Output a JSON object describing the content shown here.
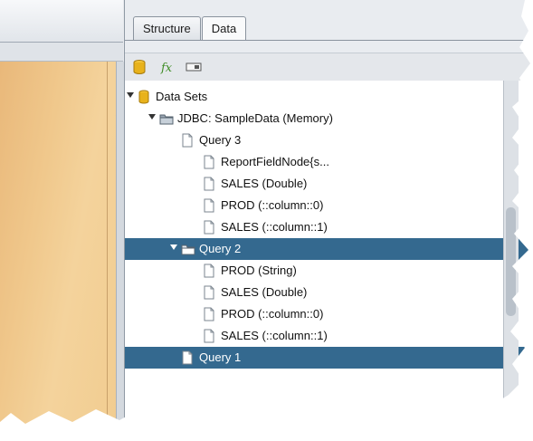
{
  "tabs": [
    {
      "label": "Structure",
      "active": false
    },
    {
      "label": "Data",
      "active": true
    }
  ],
  "toolbar": {
    "buttons": [
      {
        "icon": "database-icon"
      },
      {
        "icon": "function-icon",
        "label": "fx"
      },
      {
        "icon": "parameter-icon"
      }
    ]
  },
  "tree": {
    "nodes": [
      {
        "label": "Data Sets",
        "icon": "database-icon",
        "level": 0,
        "expanded": true,
        "selected": false
      },
      {
        "label": "JDBC: SampleData (Memory)",
        "icon": "folder-icon",
        "level": 1,
        "expanded": true,
        "selected": false
      },
      {
        "label": "Query 3",
        "icon": "document-icon",
        "level": 2,
        "selected": false
      },
      {
        "label": "ReportFieldNode{s...",
        "icon": "document-icon",
        "level": 3,
        "selected": false
      },
      {
        "label": "SALES (Double)",
        "icon": "document-icon",
        "level": 3,
        "selected": false
      },
      {
        "label": "PROD (::column::0)",
        "icon": "document-icon",
        "level": 3,
        "selected": false
      },
      {
        "label": "SALES (::column::1)",
        "icon": "document-icon",
        "level": 3,
        "selected": false
      },
      {
        "label": "Query 2",
        "icon": "folder-icon",
        "level": 2,
        "expanded": true,
        "selected": true
      },
      {
        "label": "PROD (String)",
        "icon": "document-icon",
        "level": 3,
        "selected": false
      },
      {
        "label": "SALES (Double)",
        "icon": "document-icon",
        "level": 3,
        "selected": false
      },
      {
        "label": "PROD (::column::0)",
        "icon": "document-icon",
        "level": 3,
        "selected": false
      },
      {
        "label": "SALES (::column::1)",
        "icon": "document-icon",
        "level": 3,
        "selected": false
      },
      {
        "label": "Query 1",
        "icon": "document-icon",
        "level": 2,
        "selected": true
      }
    ]
  },
  "colors": {
    "selection": "#34698f",
    "canvas": "#f0c88c",
    "database": "#e8b21c"
  }
}
